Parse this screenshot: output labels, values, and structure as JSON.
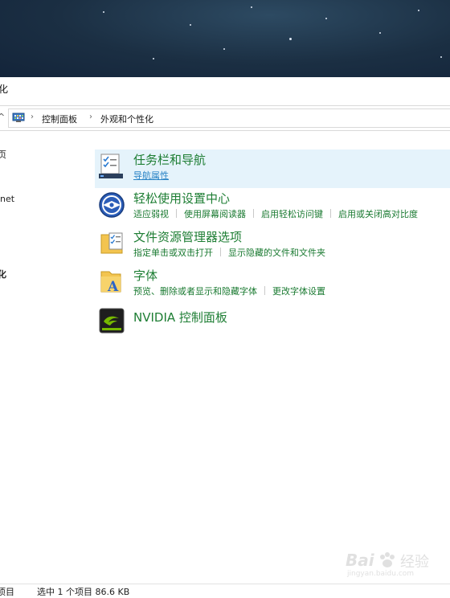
{
  "window": {
    "title_fragment": "化"
  },
  "address_bar": {
    "crumbs": [
      "控制面板",
      "外观和个性化"
    ]
  },
  "sidebar": {
    "fragments": [
      "页",
      "net",
      "化"
    ]
  },
  "items": [
    {
      "heading": "任务栏和导航",
      "links": [
        "导航属性"
      ],
      "icon": "taskbar-icon"
    },
    {
      "heading": "轻松使用设置中心",
      "links": [
        "适应弱视",
        "使用屏幕阅读器",
        "启用轻松访问键",
        "启用或关闭高对比度"
      ],
      "icon": "ease-of-access-icon"
    },
    {
      "heading": "文件资源管理器选项",
      "links": [
        "指定单击或双击打开",
        "显示隐藏的文件和文件夹"
      ],
      "icon": "folder-options-icon"
    },
    {
      "heading": "字体",
      "links": [
        "预览、删除或者显示和隐藏字体",
        "更改字体设置"
      ],
      "icon": "fonts-icon"
    },
    {
      "heading": "NVIDIA 控制面板",
      "links": [],
      "icon": "nvidia-icon"
    }
  ],
  "status_bar": {
    "item_count_fragment": "项目",
    "selection_text": "选中 1 个项目  86.6 KB"
  },
  "watermark": {
    "brand": "Bai",
    "sub": "经验",
    "url": "jingyan.baidu.com"
  },
  "colors": {
    "heading_green": "#1e7e34",
    "link_blue": "#2a84c6",
    "selection": "#e5f3fb"
  }
}
